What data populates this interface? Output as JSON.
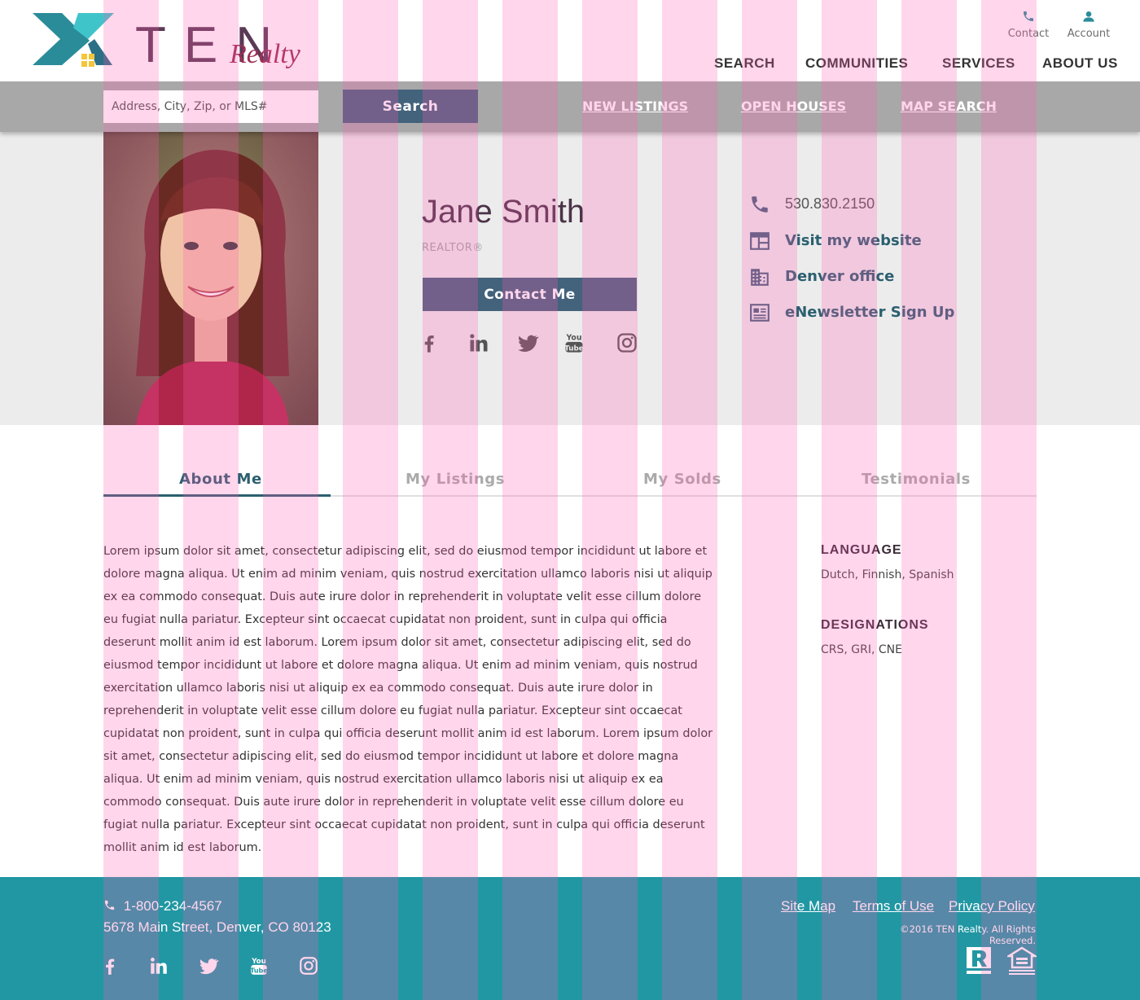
{
  "brand": {
    "name": "TEN",
    "subname": "Realty"
  },
  "utility": {
    "contact": "Contact",
    "account": "Account"
  },
  "nav": {
    "items": [
      "SEARCH",
      "COMMUNITIES",
      "SERVICES",
      "ABOUT US"
    ]
  },
  "search": {
    "placeholder": "Address, City, Zip, or MLS#",
    "button": "Search",
    "links": [
      "NEW LISTINGS",
      "OPEN HOUSES",
      "MAP SEARCH"
    ]
  },
  "agent": {
    "name": "Jane Smith",
    "title": "REALTOR®",
    "contact_button": "Contact Me",
    "social": [
      "facebook-icon",
      "linkedin-icon",
      "twitter-icon",
      "youtube-icon",
      "instagram-icon"
    ],
    "info": [
      {
        "icon": "phone-icon",
        "text": "530.830.2150"
      },
      {
        "icon": "website-icon",
        "text": "Visit my website"
      },
      {
        "icon": "office-building-icon",
        "text": "Denver office"
      },
      {
        "icon": "newsletter-icon",
        "text": "eNewsletter Sign Up"
      }
    ]
  },
  "tabs": {
    "items": [
      "About Me",
      "My Listings",
      "My Solds",
      "Testimonials"
    ],
    "active": "About Me"
  },
  "about": {
    "bio": "Lorem ipsum dolor sit amet, consectetur adipiscing elit, sed do eiusmod tempor incididunt ut labore et dolore magna aliqua. Ut enim ad minim veniam, quis nostrud exercitation ullamco laboris nisi ut aliquip ex ea commodo consequat. Duis aute irure dolor in reprehenderit in voluptate velit esse cillum dolore eu fugiat nulla pariatur. Excepteur sint occaecat cupidatat non proident, sunt in culpa qui officia deserunt mollit anim id est laborum. Lorem ipsum dolor sit amet, consectetur adipiscing elit, sed do eiusmod tempor incididunt ut labore et dolore magna aliqua. Ut enim ad minim veniam, quis nostrud exercitation ullamco laboris nisi ut aliquip ex ea commodo consequat. Duis aute irure dolor in reprehenderit in voluptate velit esse cillum dolore eu fugiat nulla pariatur. Excepteur sint occaecat cupidatat non proident, sunt in culpa qui officia deserunt mollit anim id est laborum. Lorem ipsum dolor sit amet, consectetur adipiscing elit, sed do eiusmod tempor incididunt ut labore et dolore magna aliqua. Ut enim ad minim veniam, quis nostrud exercitation ullamco laboris nisi ut aliquip ex ea commodo consequat. Duis aute irure dolor in reprehenderit in voluptate velit esse cillum dolore eu fugiat nulla pariatur. Excepteur sint occaecat cupidatat non proident, sunt in culpa qui officia deserunt mollit anim id est laborum.",
    "language_label": "LANGUAGE",
    "language_value": "Dutch, Finnish, Spanish",
    "designations_label": "DESIGNATIONS",
    "designations_value": "CRS, GRI, CNE"
  },
  "footer": {
    "phone": "1-800-234-4567",
    "address": "5678 Main Street, Denver, CO 80123",
    "links": [
      "Site Map",
      "Terms of Use",
      "Privacy Policy"
    ],
    "copyright": "©2016 TEN Realty. All Rights Reserved.",
    "badges": [
      "realtor-logo-icon",
      "equal-housing-opportunity-icon"
    ]
  },
  "colors": {
    "primary": "#43627c",
    "accent_text": "#2b5f70",
    "footer_bg": "#2197a3",
    "profile_bg": "#ececec",
    "searchbar_bg": "#a8a8a8",
    "grid_overlay": "#ff5ab4"
  }
}
